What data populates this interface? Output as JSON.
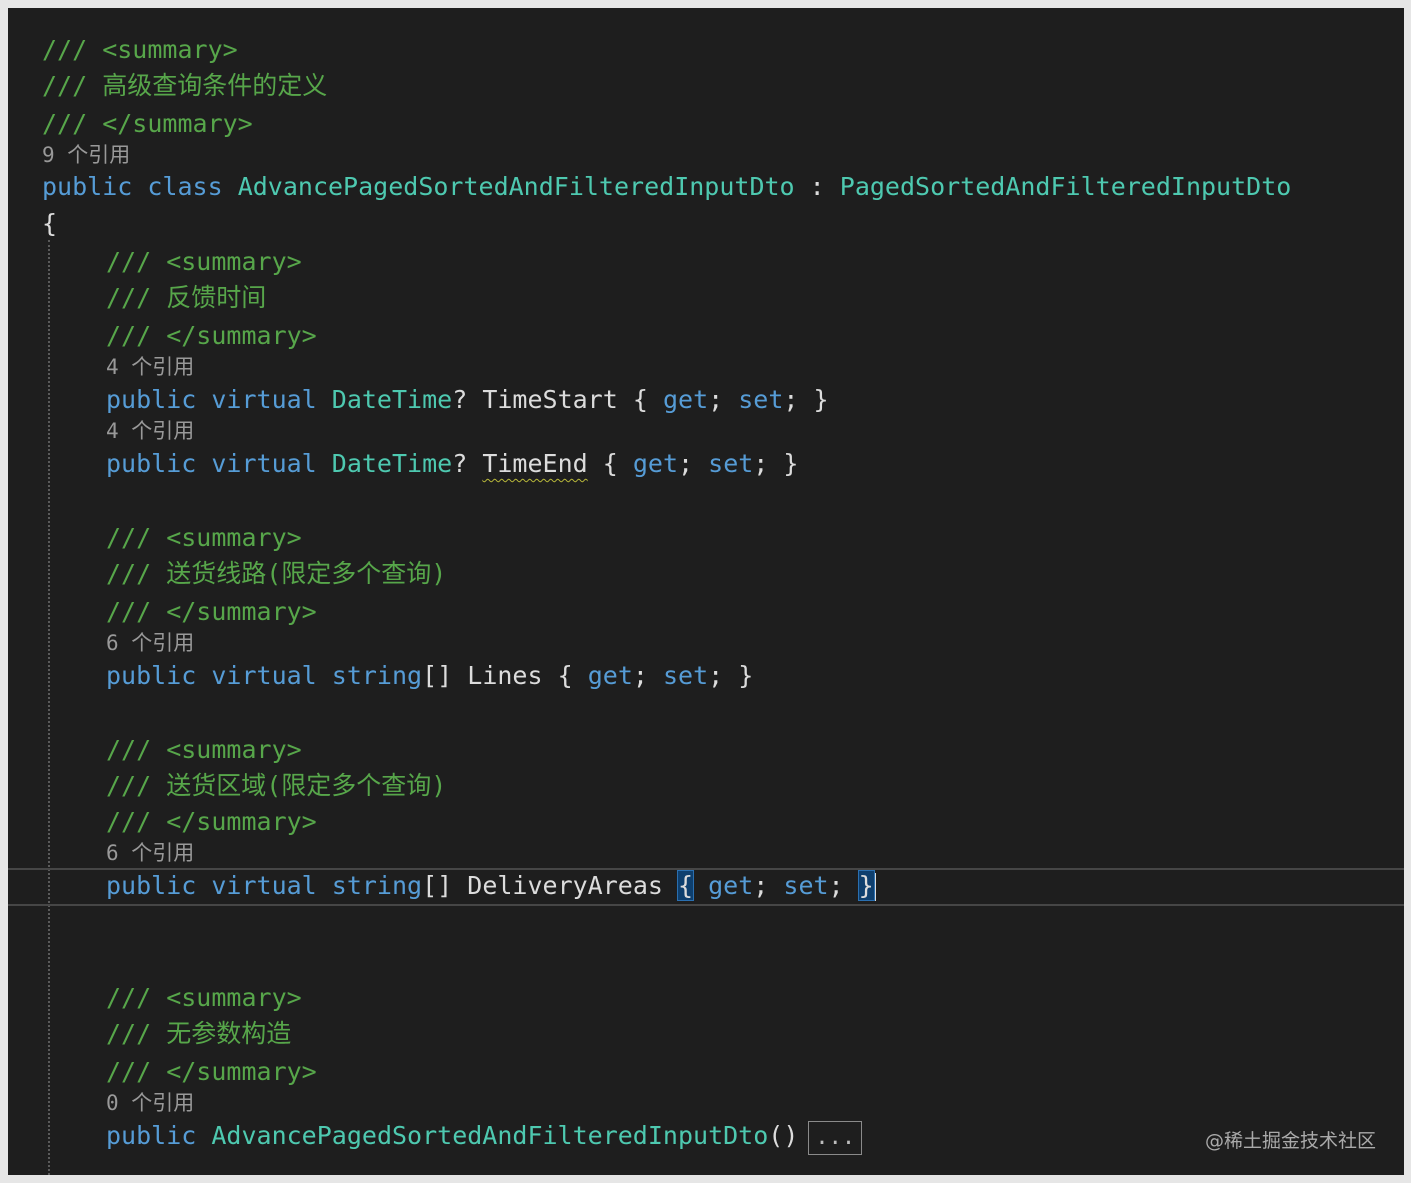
{
  "watermark": "@稀土掘金技术社区",
  "code": {
    "doc_open": "/// <summary>",
    "doc_close": "/// </summary>",
    "class_doc": "/// 高级查询条件的定义",
    "class_refs": "9 个引用",
    "class_decl": {
      "public": "public",
      "class": "class",
      "name": "AdvancePagedSortedAndFilteredInputDto",
      "sep": " : ",
      "base": "PagedSortedAndFilteredInputDto"
    },
    "open_brace": "{",
    "members": [
      {
        "doc": "/// 反馈时间",
        "refs": "4 个引用",
        "modifiers": "public virtual",
        "type": "DateTime",
        "type_suffix": "?",
        "name": "TimeStart",
        "accessors_open": "{",
        "get": "get",
        "set": "set",
        "accessors_close": "}"
      },
      {
        "refs": "4 个引用",
        "modifiers": "public virtual",
        "type": "DateTime",
        "type_suffix": "?",
        "name": "TimeEnd",
        "accessors_open": "{",
        "get": "get",
        "set": "set",
        "accessors_close": "}"
      },
      {
        "doc": "/// 送货线路(限定多个查询)",
        "refs": "6 个引用",
        "modifiers": "public virtual",
        "type": "string",
        "type_suffix": "[]",
        "name": "Lines",
        "accessors_open": "{",
        "get": "get",
        "set": "set",
        "accessors_close": "}"
      },
      {
        "doc": "/// 送货区域(限定多个查询)",
        "refs": "6 个引用",
        "modifiers": "public virtual",
        "type": "string",
        "type_suffix": "[]",
        "name": "DeliveryAreas",
        "accessors_open": "{",
        "get": "get",
        "set": "set",
        "accessors_close": "}"
      }
    ],
    "ctor": {
      "doc": "/// 无参数构造",
      "refs": "0 个引用",
      "public": "public",
      "name": "AdvancePagedSortedAndFilteredInputDto",
      "parens": "()",
      "collapsed": "..."
    }
  }
}
